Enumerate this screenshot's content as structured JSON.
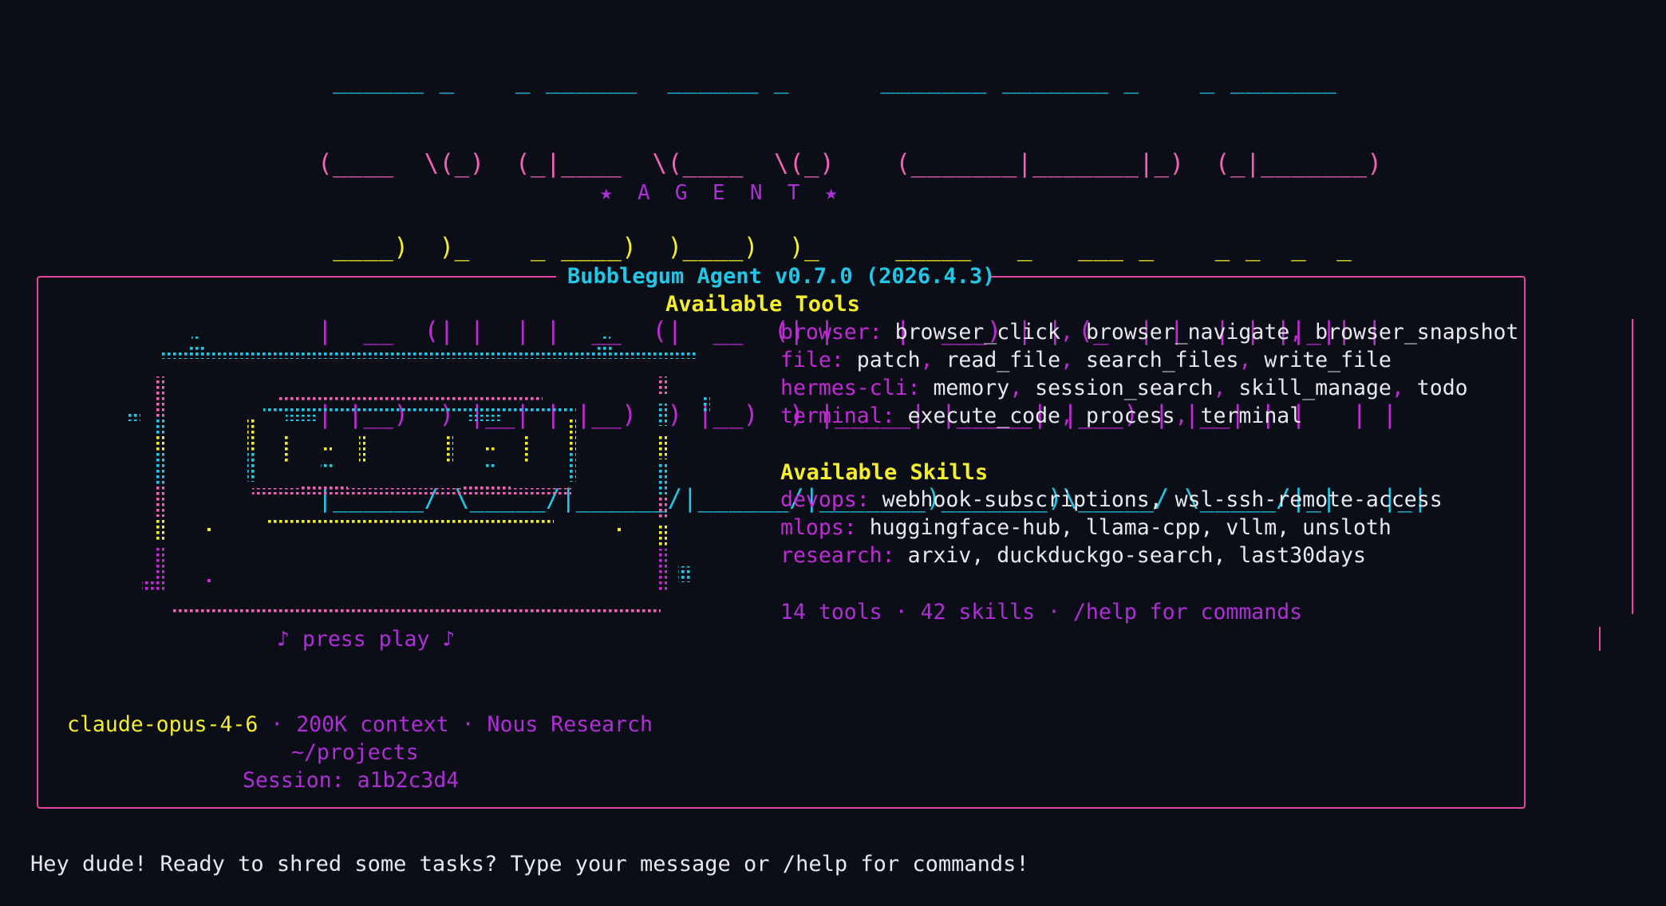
{
  "logo": {
    "lines": [
      {
        "color": "cyan",
        "text": " ______ _    _ ______  ______ _      _______ _______ _    _ _______"
      },
      {
        "color": "pink",
        "text": "(____  \\(_)  (_|____  \\(____  \\(_)    (_______|_______|_)  (_|_______)"
      },
      {
        "color": "yellow",
        "text": " ____)  )_    _ ____)  )____)  )_     _____   _   ___ _    _ _  _  _"
      },
      {
        "color": "magenta",
        "text": "|  __  (| |  | |  __  (|  __  (| |    |  ___) | | (_  | |  | | ||_|| |"
      },
      {
        "color": "magenta",
        "text": "| |__)  ) |__| | |__)  ) |__)  ) |_____| |_____| |___) | |__| | |   | |"
      },
      {
        "color": "cyan",
        "text": "|______/ \\_____/|______/|______/|_______)_______)\\_____/ \\_____/|_|   |_|"
      }
    ],
    "subtitle": "★  A  G  E  N  T  ★"
  },
  "panel": {
    "title": "Bubblegum Agent v0.7.0 (2026.4.3)",
    "tools_heading": "Available Tools",
    "tools": [
      {
        "category": "browser:",
        "items": [
          "browser_click",
          "browser_navigate",
          "browser_snapshot"
        ]
      },
      {
        "category": "file:",
        "items": [
          "patch",
          "read_file",
          "search_files",
          "write_file"
        ]
      },
      {
        "category": "hermes-cli:",
        "items": [
          "memory",
          "session_search",
          "skill_manage",
          "todo"
        ]
      },
      {
        "category": "terminal:",
        "items": [
          "execute_code",
          "process",
          "terminal"
        ]
      }
    ],
    "skills_heading": "Available Skills",
    "skills": [
      {
        "category": "devops:",
        "items_text": "webhook-subscriptions, wsl-ssh-remote-access"
      },
      {
        "category": "mlops:",
        "items_text": "huggingface-hub, llama-cpp, vllm, unsloth"
      },
      {
        "category": "research:",
        "items_text": "arxiv, duckduckgo-search, last30days"
      }
    ],
    "summary": "14 tools · 42 skills · /help for commands",
    "press_play": "♪ press play ♪",
    "model": "claude-opus-4-6",
    "separator": " · ",
    "context": "200K context",
    "org": "Nous Research",
    "cwd": "~/projects",
    "session": "Session: a1b2c3d4"
  },
  "greeting": "Hey dude! Ready to shred some tasks? Type your message or /help for commands!",
  "colors": {
    "background": "#0b0e16",
    "cyan": "#22c7e8",
    "pink": "#f062b8",
    "yellow": "#f4ef2a",
    "magenta": "#c12bd6",
    "border": "#e2489f"
  }
}
